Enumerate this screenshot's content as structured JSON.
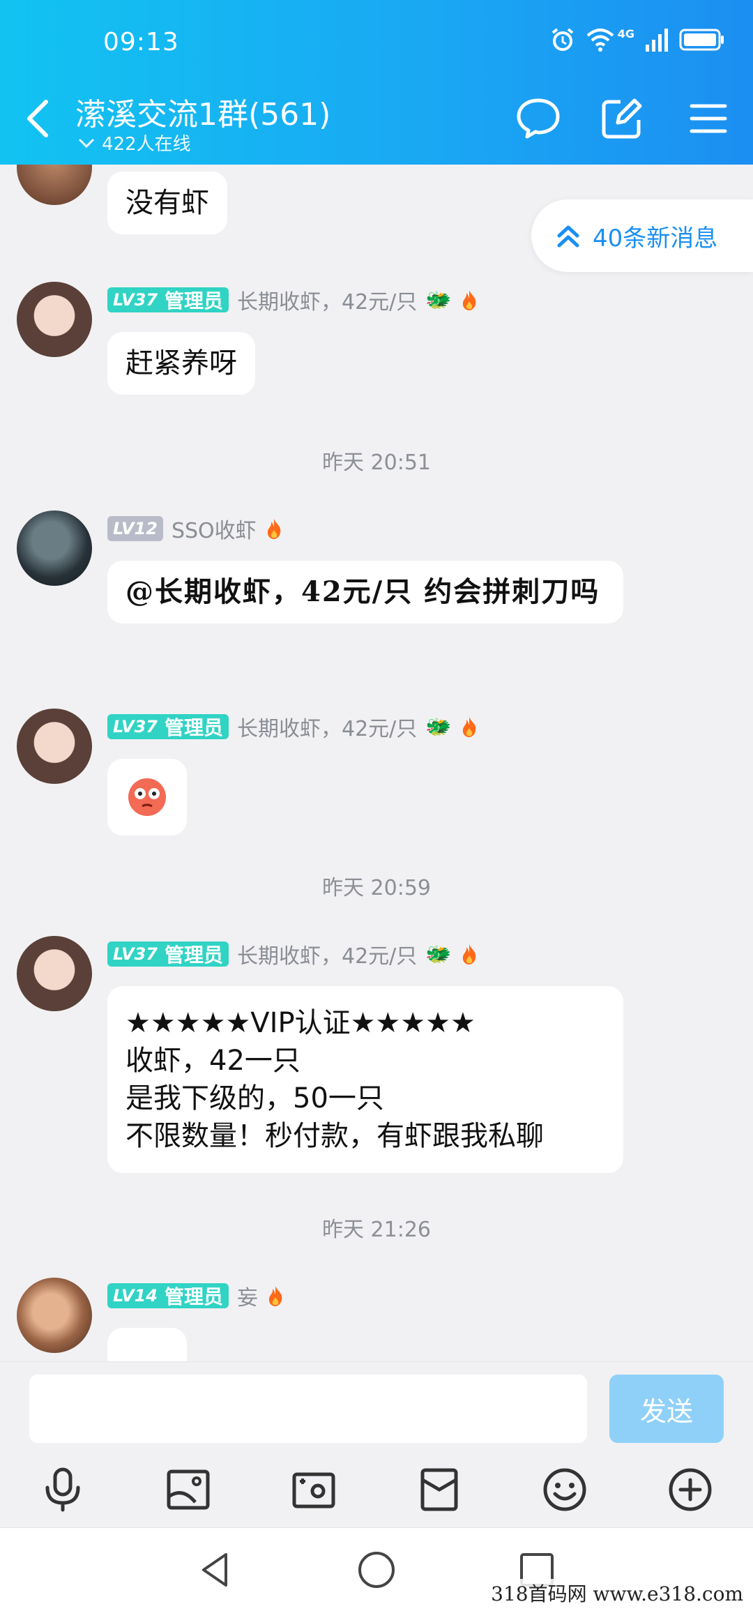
{
  "status_bar": {
    "time": "09:13",
    "network": "4G"
  },
  "header": {
    "title": "潆溪交流1群(561)",
    "online": "422人在线"
  },
  "new_messages": "40条新消息",
  "messages": [
    {
      "text": "没有虾"
    },
    {
      "level": "LV37",
      "role": "管理员",
      "name": "长期收虾，42元/只",
      "text": "赶紧养呀"
    },
    {
      "timestamp": "昨天 20:51"
    },
    {
      "level": "LV12",
      "name": "SSO收虾",
      "text": "@长期收虾，42元/只 约会拼刺刀吗"
    },
    {
      "level": "LV37",
      "role": "管理员",
      "name": "长期收虾，42元/只",
      "emoji": "flushed-face"
    },
    {
      "timestamp": "昨天 20:59"
    },
    {
      "level": "LV37",
      "role": "管理员",
      "name": "长期收虾，42元/只",
      "lines": [
        "★★★★★VIP认证★★★★★",
        "收虾，42一只",
        "是我下级的，50一只",
        "不限数量！秒付款，有虾跟我私聊"
      ]
    },
    {
      "timestamp": "昨天 21:26"
    },
    {
      "level": "LV14",
      "role": "管理员",
      "name": "妄"
    }
  ],
  "input": {
    "placeholder": "",
    "send_label": "发送"
  },
  "toolbar_icons": [
    "microphone-icon",
    "image-icon",
    "camera-icon",
    "red-packet-icon",
    "emoji-icon",
    "plus-icon"
  ],
  "watermark": "318首码网  www.e318.com",
  "colors": {
    "header": "#1aa6f3",
    "admin_badge": "#30d3c4",
    "accent": "#1a8ff2",
    "send_disabled": "#8fd0f9"
  }
}
